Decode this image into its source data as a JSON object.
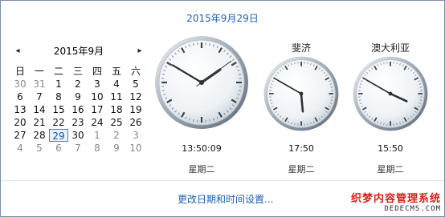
{
  "header": {
    "date": "2015年9月29日"
  },
  "calendar": {
    "title": "2015年9月",
    "prev_icon": "◂",
    "next_icon": "▸",
    "weekdays": [
      "日",
      "一",
      "二",
      "三",
      "四",
      "五",
      "六"
    ],
    "days": [
      {
        "label": "30",
        "month": "other"
      },
      {
        "label": "31",
        "month": "other"
      },
      {
        "label": "1",
        "month": "current"
      },
      {
        "label": "2",
        "month": "current"
      },
      {
        "label": "3",
        "month": "current"
      },
      {
        "label": "4",
        "month": "current"
      },
      {
        "label": "5",
        "month": "current"
      },
      {
        "label": "6",
        "month": "current"
      },
      {
        "label": "7",
        "month": "current"
      },
      {
        "label": "8",
        "month": "current"
      },
      {
        "label": "9",
        "month": "current"
      },
      {
        "label": "10",
        "month": "current"
      },
      {
        "label": "11",
        "month": "current"
      },
      {
        "label": "12",
        "month": "current"
      },
      {
        "label": "13",
        "month": "current"
      },
      {
        "label": "14",
        "month": "current"
      },
      {
        "label": "15",
        "month": "current"
      },
      {
        "label": "16",
        "month": "current"
      },
      {
        "label": "17",
        "month": "current"
      },
      {
        "label": "18",
        "month": "current"
      },
      {
        "label": "19",
        "month": "current"
      },
      {
        "label": "20",
        "month": "current"
      },
      {
        "label": "21",
        "month": "current"
      },
      {
        "label": "22",
        "month": "current"
      },
      {
        "label": "23",
        "month": "current"
      },
      {
        "label": "24",
        "month": "current"
      },
      {
        "label": "25",
        "month": "current"
      },
      {
        "label": "26",
        "month": "current"
      },
      {
        "label": "27",
        "month": "current"
      },
      {
        "label": "28",
        "month": "current"
      },
      {
        "label": "29",
        "month": "current",
        "today": true
      },
      {
        "label": "30",
        "month": "current"
      },
      {
        "label": "1",
        "month": "other"
      },
      {
        "label": "2",
        "month": "other"
      },
      {
        "label": "3",
        "month": "other"
      },
      {
        "label": "4",
        "month": "other"
      },
      {
        "label": "5",
        "month": "other"
      },
      {
        "label": "6",
        "month": "other"
      },
      {
        "label": "7",
        "month": "other"
      },
      {
        "label": "8",
        "month": "other"
      },
      {
        "label": "9",
        "month": "other"
      },
      {
        "label": "10",
        "month": "other"
      }
    ]
  },
  "clocks": [
    {
      "city": "",
      "time": "13:50:09",
      "weekday": "星期二",
      "hour": 13,
      "minute": 50,
      "second": 9,
      "show_seconds": true
    },
    {
      "city": "斐济",
      "time": "17:50",
      "weekday": "星期二",
      "hour": 17,
      "minute": 50,
      "second": 0,
      "show_seconds": false
    },
    {
      "city": "澳大利亚",
      "time": "15:50",
      "weekday": "星期二",
      "hour": 15,
      "minute": 50,
      "second": 0,
      "show_seconds": false
    }
  ],
  "footer": {
    "settings_link": "更改日期和时间设置..."
  },
  "watermark": {
    "line1": "织梦内容管理系统",
    "line2": "DEDECMS.COM"
  },
  "colors": {
    "link": "#1d5fb8",
    "today_border": "#3c7fd6"
  }
}
